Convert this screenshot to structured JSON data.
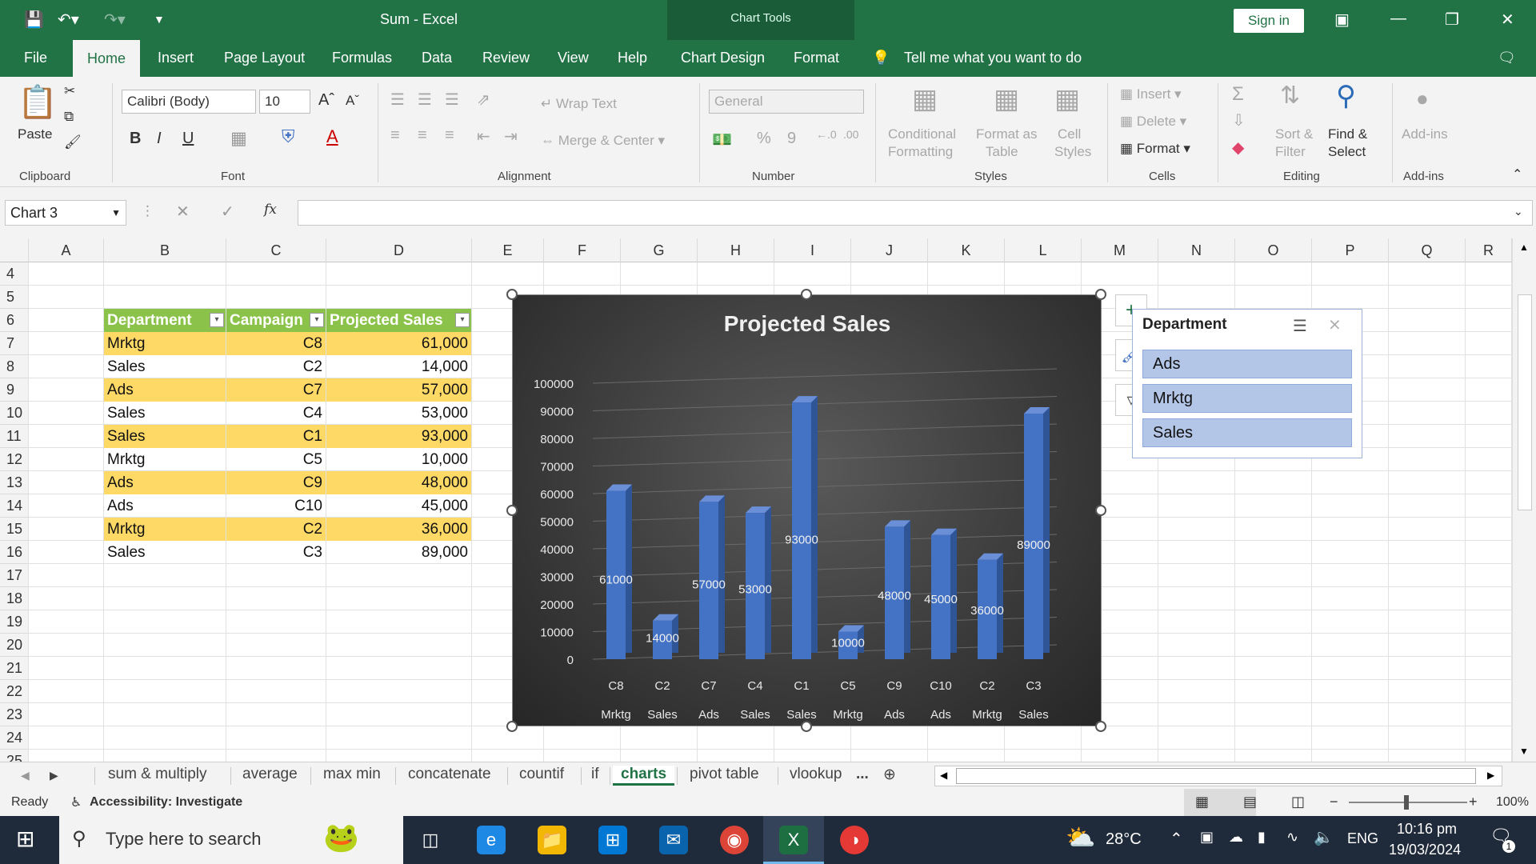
{
  "window": {
    "title": "Sum  -  Excel",
    "chart_tools": "Chart Tools",
    "sign_in": "Sign in"
  },
  "tabs": [
    "File",
    "Home",
    "Insert",
    "Page Layout",
    "Formulas",
    "Data",
    "Review",
    "View",
    "Help",
    "Chart Design",
    "Format"
  ],
  "tell_me": "Tell me what you want to do",
  "ribbon": {
    "clipboard": {
      "paste": "Paste",
      "label": "Clipboard"
    },
    "font": {
      "name": "Calibri (Body)",
      "size": "10",
      "bold": "B",
      "italic": "I",
      "underline": "U",
      "label": "Font"
    },
    "alignment": {
      "wrap": "Wrap Text",
      "merge": "Merge & Center",
      "label": "Alignment"
    },
    "number": {
      "format": "General",
      "percent": "%",
      "comma": "9",
      "label": "Number"
    },
    "styles": {
      "cond1": "Conditional",
      "cond2": "Formatting",
      "fmt1": "Format as",
      "fmt2": "Table",
      "cell1": "Cell",
      "cell2": "Styles",
      "label": "Styles"
    },
    "cells": {
      "insert": "Insert",
      "delete": "Delete",
      "format": "Format",
      "label": "Cells"
    },
    "editing": {
      "sort1": "Sort &",
      "sort2": "Filter",
      "find1": "Find &",
      "find2": "Select",
      "label": "Editing"
    },
    "addins": {
      "btn": "Add-ins",
      "label": "Add-ins"
    }
  },
  "namebox": "Chart 3",
  "fx": "fx",
  "columns": [
    "A",
    "B",
    "C",
    "D",
    "E",
    "F",
    "G",
    "H",
    "I",
    "J",
    "K",
    "L",
    "M",
    "N",
    "O",
    "P",
    "Q",
    "R"
  ],
  "rows": [
    "4",
    "5",
    "6",
    "7",
    "8",
    "9",
    "10",
    "11",
    "12",
    "13",
    "14",
    "15",
    "16",
    "17",
    "18",
    "19",
    "20",
    "21",
    "22",
    "23",
    "24",
    "25"
  ],
  "table": {
    "headers": [
      "Department",
      "Campaign",
      "Projected Sales"
    ],
    "rows": [
      [
        "Mrktg",
        "C8",
        "61,000"
      ],
      [
        "Sales",
        "C2",
        "14,000"
      ],
      [
        "Ads",
        "C7",
        "57,000"
      ],
      [
        "Sales",
        "C4",
        "53,000"
      ],
      [
        "Sales",
        "C1",
        "93,000"
      ],
      [
        "Mrktg",
        "C5",
        "10,000"
      ],
      [
        "Ads",
        "C9",
        "48,000"
      ],
      [
        "Ads",
        "C10",
        "45,000"
      ],
      [
        "Mrktg",
        "C2",
        "36,000"
      ],
      [
        "Sales",
        "C3",
        "89,000"
      ]
    ]
  },
  "chart_data": {
    "type": "bar",
    "title": "Projected Sales",
    "categories": [
      "C8",
      "C2",
      "C7",
      "C4",
      "C1",
      "C5",
      "C9",
      "C10",
      "C2",
      "C3"
    ],
    "groups": [
      "Mrktg",
      "Sales",
      "Ads",
      "Sales",
      "Sales",
      "Mrktg",
      "Ads",
      "Ads",
      "Mrktg",
      "Sales"
    ],
    "values": [
      61000,
      14000,
      57000,
      53000,
      93000,
      10000,
      48000,
      45000,
      36000,
      89000
    ],
    "ylim": [
      0,
      100000
    ],
    "yticks": [
      "0",
      "10000",
      "20000",
      "30000",
      "40000",
      "50000",
      "60000",
      "70000",
      "80000",
      "90000",
      "100000"
    ],
    "grid": true,
    "bar_color": "#4472c4"
  },
  "slicer": {
    "title": "Department",
    "items": [
      "Ads",
      "Mrktg",
      "Sales"
    ]
  },
  "sheets": [
    "sum & multiply",
    "average",
    "max min",
    "concatenate",
    "countif",
    "if",
    "charts",
    "pivot table",
    "vlookup",
    "..."
  ],
  "active_sheet": "charts",
  "status": {
    "ready": "Ready",
    "accessibility": "Accessibility: Investigate",
    "zoom": "100%"
  },
  "taskbar": {
    "search": "Type here to search",
    "weather": "28°C",
    "lang": "ENG",
    "time": "10:16 pm",
    "date": "19/03/2024",
    "notifications": "1"
  },
  "colors": {
    "excel_green": "#217346",
    "header_green": "#8bc34a",
    "band_yellow": "#ffd966",
    "slicer_blue": "#b4c6e7"
  }
}
